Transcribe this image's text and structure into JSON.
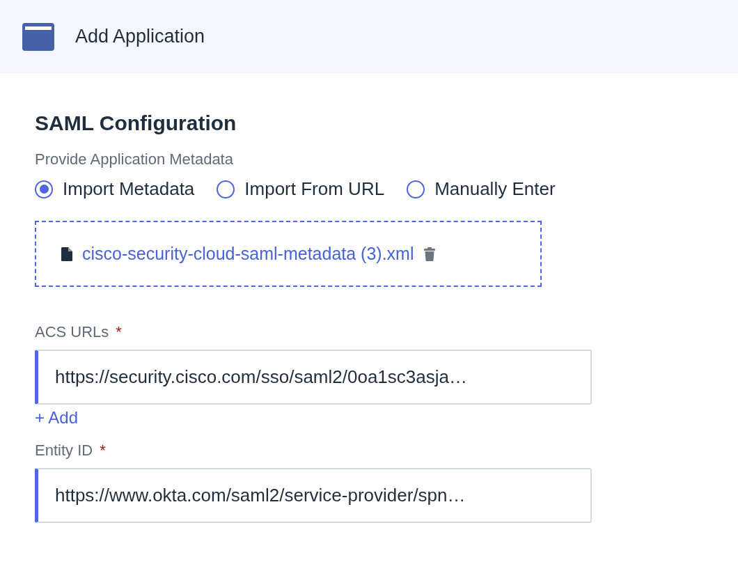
{
  "header": {
    "title": "Add Application"
  },
  "section": {
    "title": "SAML Configuration",
    "metadata_label": "Provide Application Metadata",
    "options": [
      {
        "label": "Import Metadata",
        "selected": true
      },
      {
        "label": "Import From URL",
        "selected": false
      },
      {
        "label": "Manually Enter",
        "selected": false
      }
    ],
    "file": {
      "name": "cisco-security-cloud-saml-metadata (3).xml"
    },
    "fields": [
      {
        "label": "ACS URLs",
        "required_mark": "*",
        "value": "https://security.cisco.com/sso/saml2/0oa1sc3asja…",
        "add_link": "+ Add"
      },
      {
        "label": "Entity ID",
        "required_mark": "*",
        "value": "https://www.okta.com/saml2/service-provider/spn…"
      }
    ]
  }
}
